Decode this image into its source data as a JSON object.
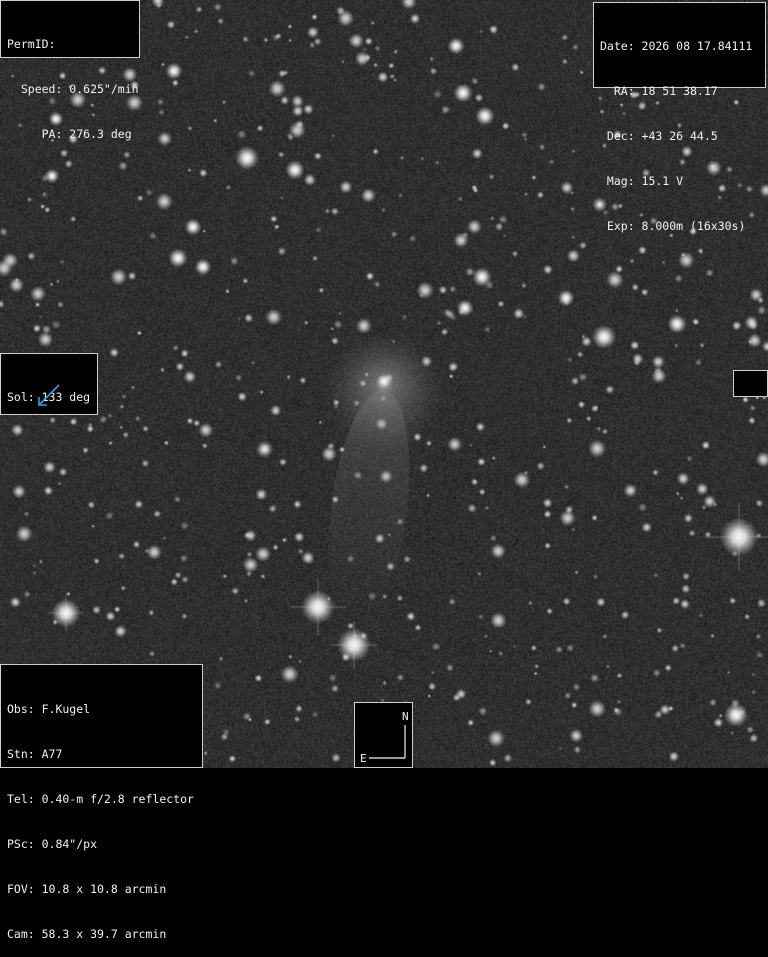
{
  "permid_panel": {
    "line1": "PermID:",
    "line2": "  Speed: 0.625\"/min",
    "line3": "     PA: 276.3 deg"
  },
  "ephemeris_panel": {
    "date": "Date: 2026 08 17.84111",
    "ra": "  RA: 18 51 38.17",
    "dec": " Dec: +43 26 44.5",
    "mag": " Mag: 15.1 V",
    "exp": " Exp: 8.000m (16x30s)"
  },
  "solar_panel": {
    "label": "Sol: 133 deg",
    "arrow_icon": "arrow-down-left-icon",
    "arrow_color": "#3b9be0"
  },
  "dash_panel": {
    "label": "---"
  },
  "observer_panel": {
    "obs": "Obs: F.Kugel",
    "stn": "Stn: A77",
    "tel": "Tel: 0.40-m f/2.8 reflector",
    "psc": "PSc: 0.84\"/px",
    "fov": "FOV: 10.8 x 10.8 arcmin",
    "cam": "Cam: 58.3 x 39.7 arcmin"
  },
  "compass": {
    "north_label": "N",
    "east_label": "E",
    "icon": "compass-icon"
  },
  "colors": {
    "sky_background": "#2b2b2b",
    "panel_border": "#cfcfcf",
    "text": "#f2f2f2"
  }
}
